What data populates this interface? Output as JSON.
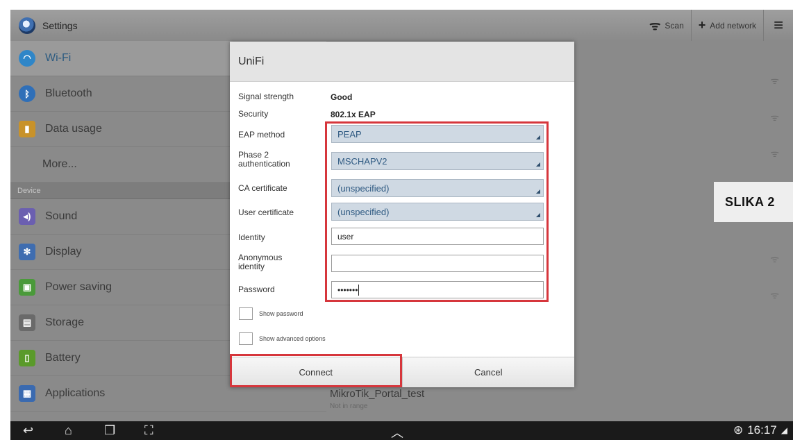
{
  "actionbar": {
    "title": "Settings",
    "scan_label": "Scan",
    "add_network_label": "Add network"
  },
  "sidebar": {
    "items": [
      {
        "label": "Wi-Fi",
        "icon": "wifi-icon",
        "color": "#2f86c8"
      },
      {
        "label": "Bluetooth",
        "icon": "bluetooth-icon",
        "color": "#2f6fb8"
      },
      {
        "label": "Data usage",
        "icon": "data-usage-icon",
        "color": "#c8922a"
      },
      {
        "label": "More..."
      }
    ],
    "device_header": "Device",
    "device_items": [
      {
        "label": "Sound",
        "icon": "sound-icon",
        "color": "#6b5fb0"
      },
      {
        "label": "Display",
        "icon": "display-icon",
        "color": "#3f6db0"
      },
      {
        "label": "Power saving",
        "icon": "power-saving-icon",
        "color": "#4a9a3a"
      },
      {
        "label": "Storage",
        "icon": "storage-icon",
        "color": "#6a6a6a"
      },
      {
        "label": "Battery",
        "icon": "battery-icon",
        "color": "#5a9a2a"
      },
      {
        "label": "Applications",
        "icon": "applications-icon",
        "color": "#3a6ab0"
      }
    ]
  },
  "network_list": {
    "bottom_network": {
      "name": "MikroTik_Portal_test",
      "status": "Not in range"
    }
  },
  "dialog": {
    "title": "UniFi",
    "signal_strength_label": "Signal strength",
    "signal_strength_value": "Good",
    "security_label": "Security",
    "security_value": "802.1x EAP",
    "eap_method_label": "EAP method",
    "eap_method_value": "PEAP",
    "phase2_label_line1": "Phase 2",
    "phase2_label_line2": "authentication",
    "phase2_value": "MSCHAPV2",
    "ca_cert_label": "CA certificate",
    "ca_cert_value": "(unspecified)",
    "user_cert_label": "User certificate",
    "user_cert_value": "(unspecified)",
    "identity_label": "Identity",
    "identity_value": "user",
    "anon_identity_label_line1": "Anonymous",
    "anon_identity_label_line2": "identity",
    "anon_identity_value": "",
    "password_label": "Password",
    "password_value": "•••••••",
    "show_password_label": "Show password",
    "show_advanced_label": "Show advanced options",
    "connect_label": "Connect",
    "cancel_label": "Cancel"
  },
  "overlay_label": "SLIKA 2",
  "statusbar": {
    "time": "16:17"
  },
  "colors": {
    "highlight": "#d6363c",
    "accent": "#2f5a82"
  }
}
